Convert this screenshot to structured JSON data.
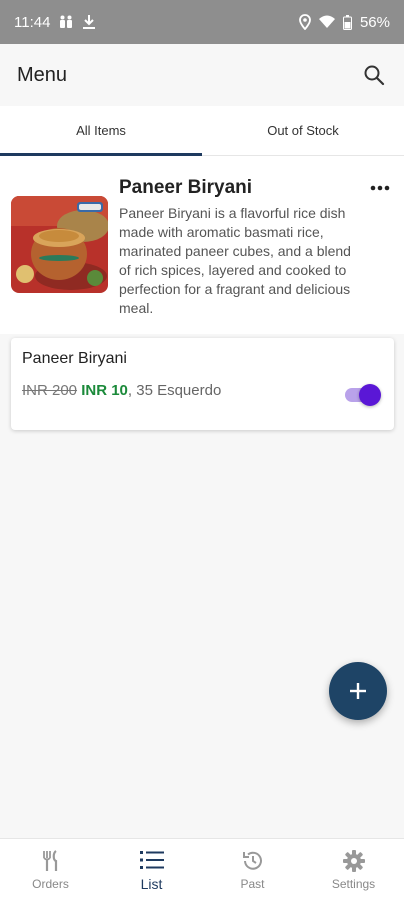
{
  "status_bar": {
    "time": "11:44",
    "battery": "56%"
  },
  "app_bar": {
    "title": "Menu",
    "search_icon": "search-icon"
  },
  "tabs": [
    {
      "label": "All Items",
      "active": true
    },
    {
      "label": "Out of Stock",
      "active": false
    }
  ],
  "product": {
    "name": "Paneer Biryani",
    "description": "Paneer Biryani is a flavorful rice dish made with aromatic basmati rice, marinated paneer cubes, and a blend of rich spices, layered and cooked to perfection for a fragrant and delicious meal.",
    "more_icon": "more-vertical-icon"
  },
  "variant": {
    "name": "Paneer Biryani",
    "old_price": "INR 200",
    "new_price": "INR 10",
    "extra": ", 35 Esquerdo",
    "in_stock": true
  },
  "fab": {
    "icon": "plus-icon"
  },
  "bottom_nav": [
    {
      "label": "Orders",
      "icon": "fork-knife-icon",
      "active": false
    },
    {
      "label": "List",
      "icon": "list-icon",
      "active": true
    },
    {
      "label": "Past",
      "icon": "history-icon",
      "active": false
    },
    {
      "label": "Settings",
      "icon": "gear-icon",
      "active": false
    }
  ],
  "colors": {
    "accent": "#1e3a5f",
    "fab": "#1e4466",
    "toggle_on": "#5a17d6",
    "price_green": "#1b8a3a"
  }
}
